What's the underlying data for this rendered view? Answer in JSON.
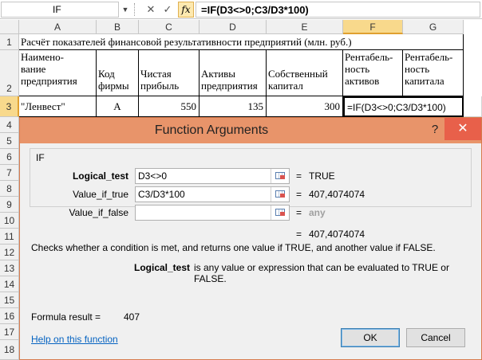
{
  "formula_bar": {
    "name_box": "IF",
    "formula": "=IF(D3<>0;C3/D3*100)",
    "cancel_glyph": "✕",
    "enter_glyph": "✓",
    "fx_label": "fx"
  },
  "columns": [
    "A",
    "B",
    "C",
    "D",
    "E",
    "F",
    "G"
  ],
  "rows": [
    "1",
    "2",
    "3",
    "4",
    "5",
    "6",
    "7",
    "8",
    "9",
    "10",
    "11",
    "12",
    "13",
    "14",
    "15",
    "16",
    "17",
    "18"
  ],
  "sheet": {
    "title": "Расчёт показателей финансовой результативности предприятий (млн. руб.)",
    "headers": {
      "a": [
        "Наимено-",
        "вание",
        "предприятия"
      ],
      "b": [
        "Код",
        "фирмы"
      ],
      "c": [
        "Чистая",
        "прибыль"
      ],
      "d": [
        "Активы",
        "предприятия"
      ],
      "e": [
        "Собственный",
        "капитал"
      ],
      "f": [
        "Рентабель-",
        "ность",
        "активов"
      ],
      "g": [
        "Рентабель-",
        "ность",
        "капитала"
      ]
    },
    "row3": {
      "name": "\"Ленвест\"",
      "code": "А",
      "profit": "550",
      "assets": "135",
      "equity": "300",
      "formula": "=IF(D3<>0;C3/D3*100)"
    }
  },
  "dialog": {
    "title": "Function Arguments",
    "help_glyph": "?",
    "close_glyph": "✕",
    "function_name": "IF",
    "args": [
      {
        "label": "Logical_test",
        "value": "D3<>0",
        "equals": "=",
        "result": "TRUE",
        "bold": true
      },
      {
        "label": "Value_if_true",
        "value": "C3/D3*100",
        "equals": "=",
        "result": "407,4074074",
        "bold": false
      },
      {
        "label": "Value_if_false",
        "value": "",
        "equals": "=",
        "result": "any",
        "bold": false
      }
    ],
    "overall_equals": "=",
    "overall_result": "407,4074074",
    "description": "Checks whether a condition is met, and returns one value if TRUE, and another value if FALSE.",
    "arg_help_name": "Logical_test",
    "arg_help_text": "is any value or expression that can be evaluated to TRUE or FALSE.",
    "formula_result_label": "Formula result =",
    "formula_result_value": "407",
    "help_link": "Help on this function",
    "ok_label": "OK",
    "cancel_label": "Cancel"
  },
  "colors": {
    "dialog_title_bg": "#e8946a",
    "close_button_bg": "#e8604a",
    "link": "#0563c1",
    "selected_header": "#f8d98c"
  }
}
